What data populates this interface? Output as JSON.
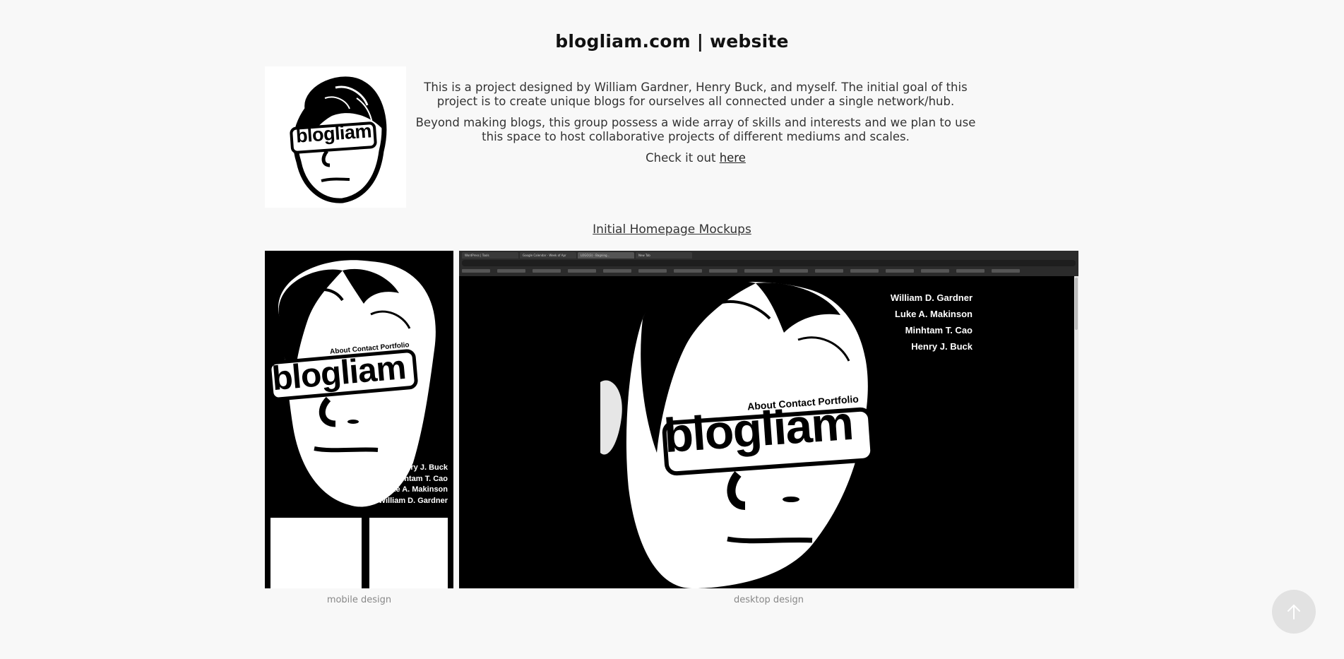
{
  "page": {
    "title": "blogliam.com | website"
  },
  "intro": {
    "paragraph1": "This is a project designed by William Gardner, Henry Buck, and myself. The initial goal of this project is to create unique blogs for ourselves all connected under a single network/hub.",
    "paragraph2": "Beyond making blogs, this group possess a wide array of skills and interests and we plan to use this space to host collaborative projects of different mediums and scales.",
    "check_prefix": "Check it out ",
    "check_link": "here"
  },
  "logo": {
    "text": "blogliam"
  },
  "section": {
    "heading": "Initial Homepage Mockups"
  },
  "mobile_mockup": {
    "nav": "About Contact Portfolio",
    "brand": "blogliam",
    "names": [
      "Henry J. Buck",
      "Minhtam T. Cao",
      "Luke A. Makinson",
      "William D. Gardner"
    ],
    "caption": "mobile design"
  },
  "desktop_mockup": {
    "tabs": [
      "WordPress | Tools",
      "Google Calendar - Week of Apr",
      "LOGO(3) - Bagning...",
      "New Tab"
    ],
    "nav": "About Contact Portfolio",
    "brand": "blogliam",
    "names": [
      "William D. Gardner",
      "Luke A. Makinson",
      "Minhtam T. Cao",
      "Henry J. Buck"
    ],
    "caption": "desktop design"
  },
  "scroll_top": {
    "icon": "arrow-up-icon"
  },
  "colors": {
    "background": "#f8f8f8",
    "text": "#333333",
    "mockup_bg": "#000000",
    "caption": "#888888"
  }
}
